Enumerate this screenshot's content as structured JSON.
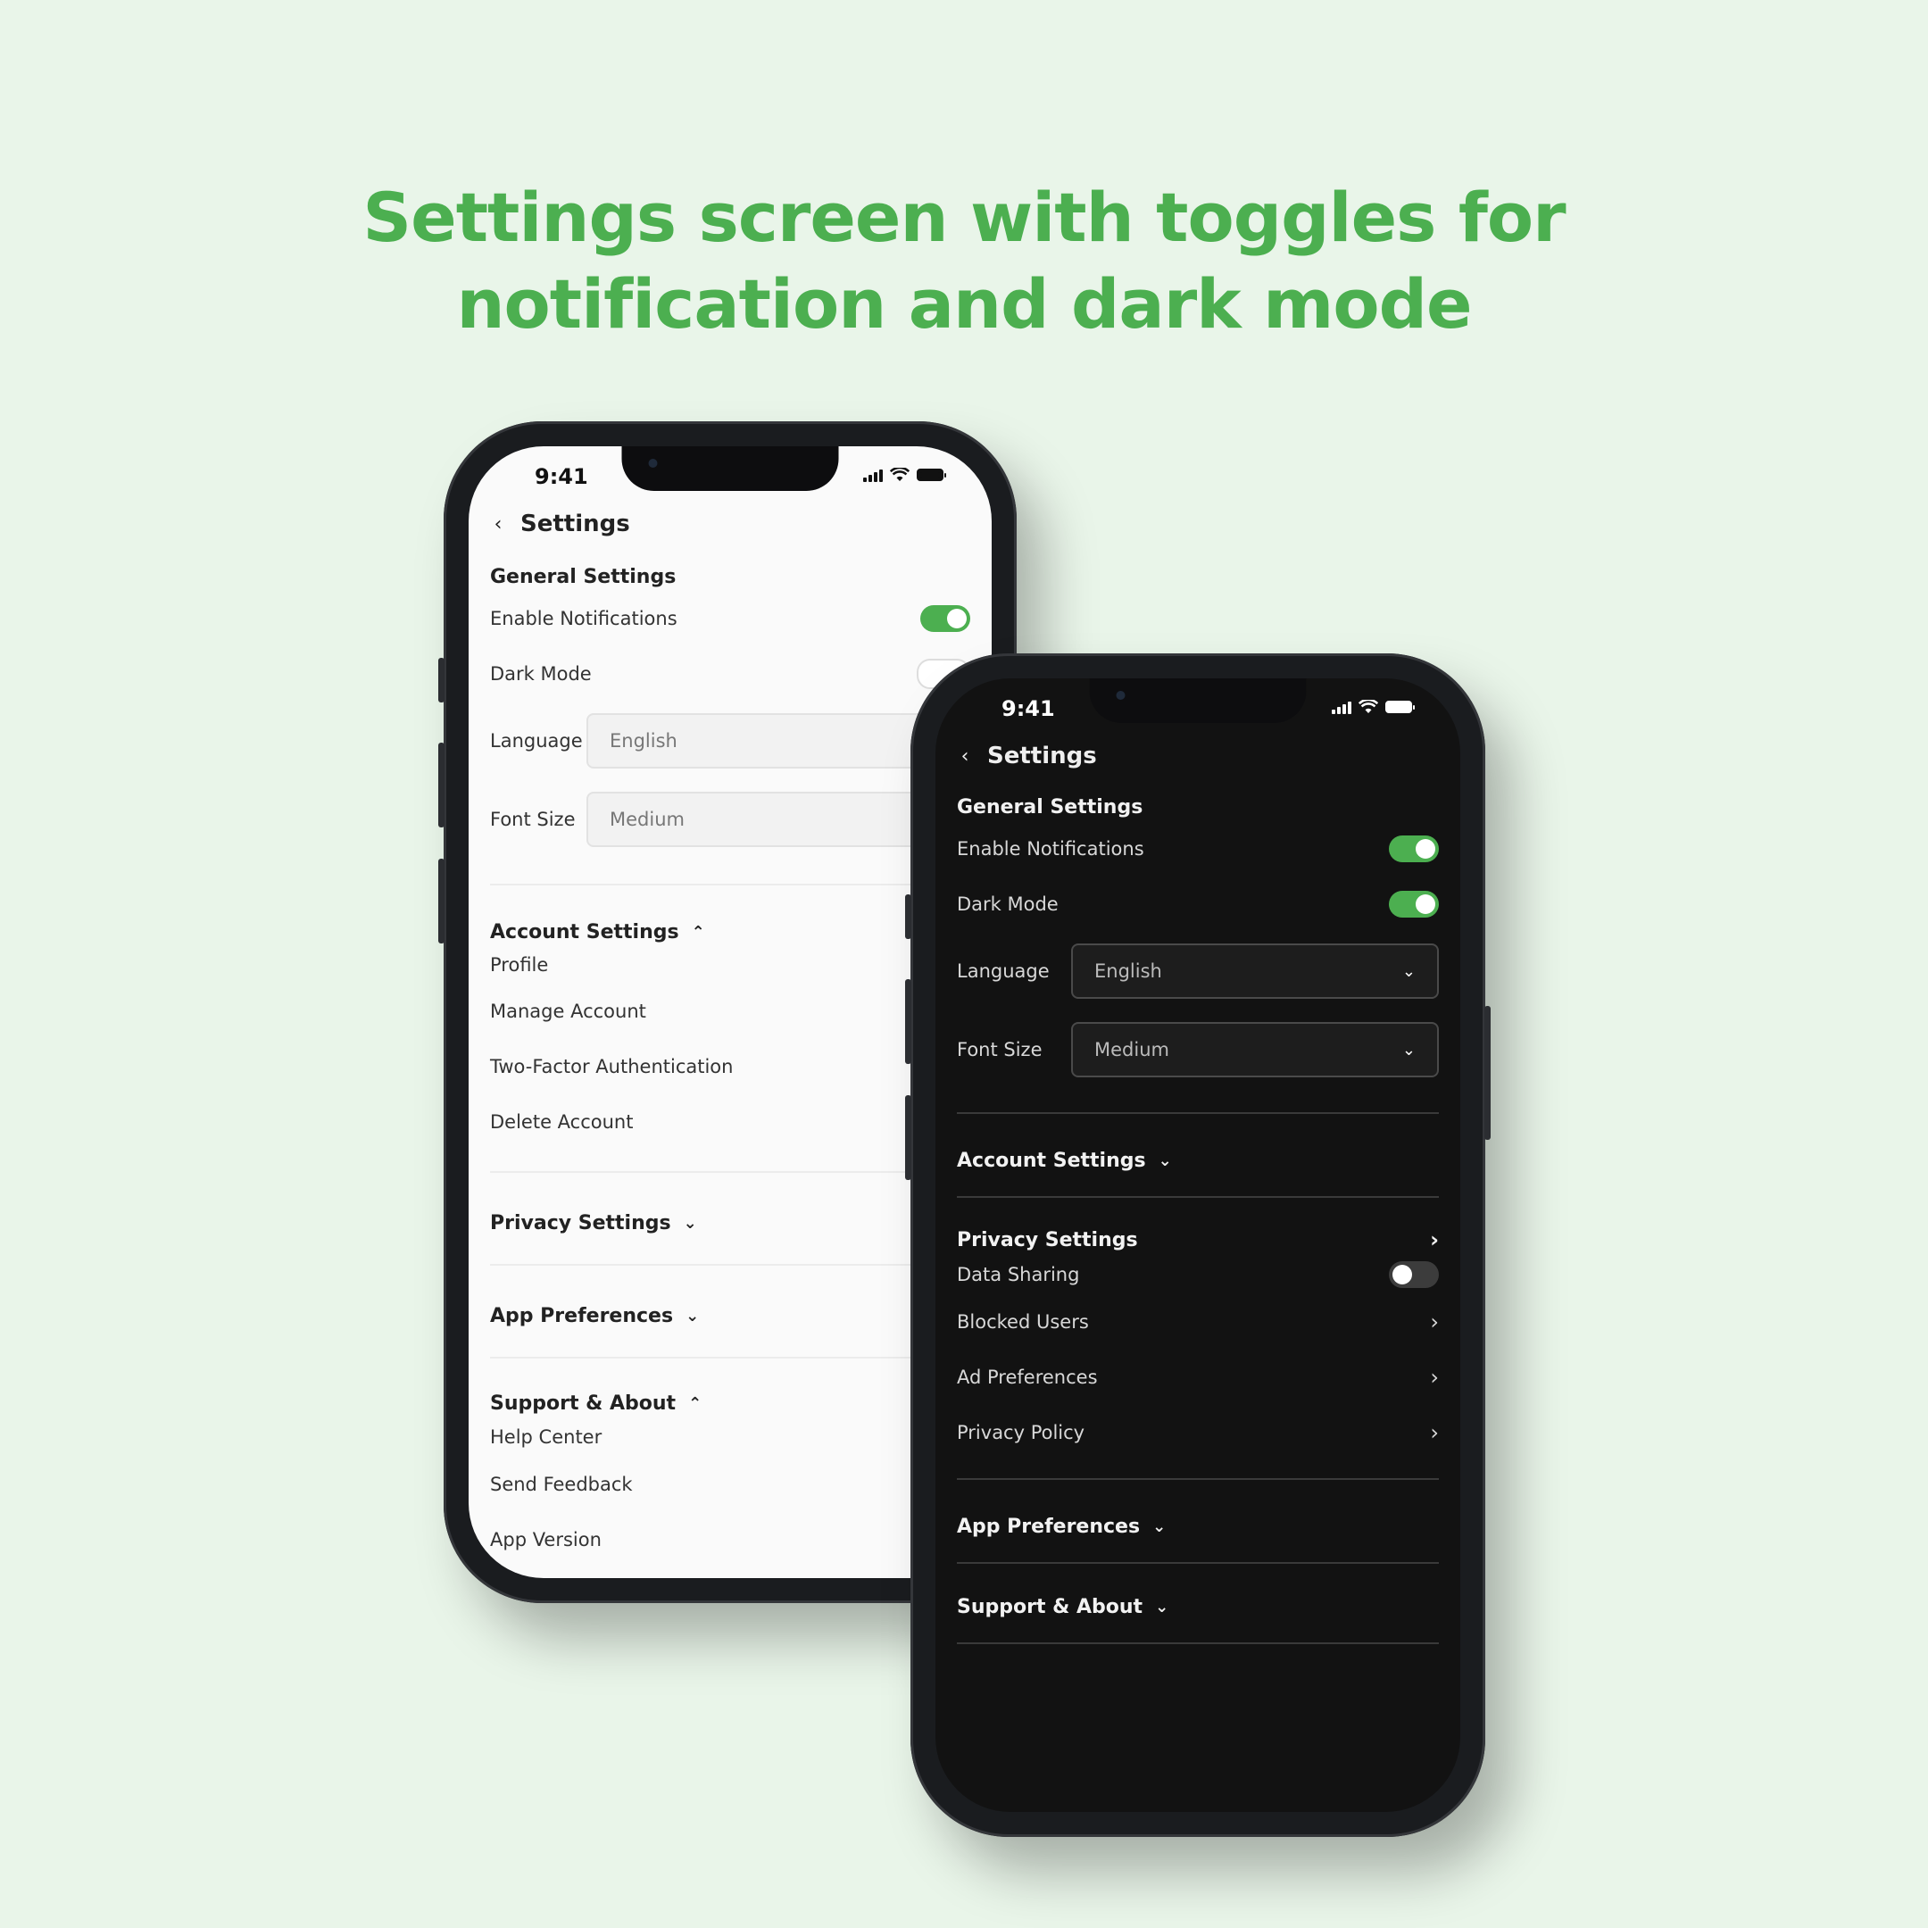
{
  "headline": {
    "line1": "Settings screen with toggles for",
    "line2": "notification and dark mode"
  },
  "colors": {
    "accent": "#4caf50",
    "background": "#e9f5e9",
    "dark_screen": "#121212",
    "light_screen": "#fafafa"
  },
  "light_phone": {
    "status": {
      "time": "9:41"
    },
    "header": {
      "title": "Settings",
      "back_icon": "chevron-left-icon"
    },
    "general": {
      "title": "General Settings",
      "notifications_label": "Enable Notifications",
      "notifications_on": true,
      "dark_mode_label": "Dark Mode",
      "dark_mode_on": false,
      "language_label": "Language",
      "language_value": "English",
      "font_size_label": "Font Size",
      "font_size_value": "Medium"
    },
    "account": {
      "title": "Account  Settings",
      "items": [
        "Profile",
        "Manage Account",
        "Two-Factor Authentication",
        "Delete Account"
      ]
    },
    "privacy": {
      "title": "Privacy Settings"
    },
    "app_prefs": {
      "title": "App Preferences"
    },
    "support": {
      "title": "Support & About",
      "items": [
        "Help Center",
        "Send Feedback",
        "App Version"
      ]
    }
  },
  "dark_phone": {
    "status": {
      "time": "9:41"
    },
    "header": {
      "title": "Settings",
      "back_icon": "chevron-left-icon"
    },
    "general": {
      "title": "General Settings",
      "notifications_label": "Enable Notifications",
      "notifications_on": true,
      "dark_mode_label": "Dark Mode",
      "dark_mode_on": true,
      "language_label": "Language",
      "language_value": "English",
      "font_size_label": "Font Size",
      "font_size_value": "Medium"
    },
    "account": {
      "title": "Account Settings"
    },
    "privacy": {
      "title": "Privacy Settings",
      "data_sharing_label": "Data Sharing",
      "data_sharing_on": false,
      "items": [
        "Blocked Users",
        "Ad Preferences",
        "Privacy Policy"
      ]
    },
    "app_prefs": {
      "title": "App Preferences"
    },
    "support": {
      "title": "Support & About"
    }
  }
}
